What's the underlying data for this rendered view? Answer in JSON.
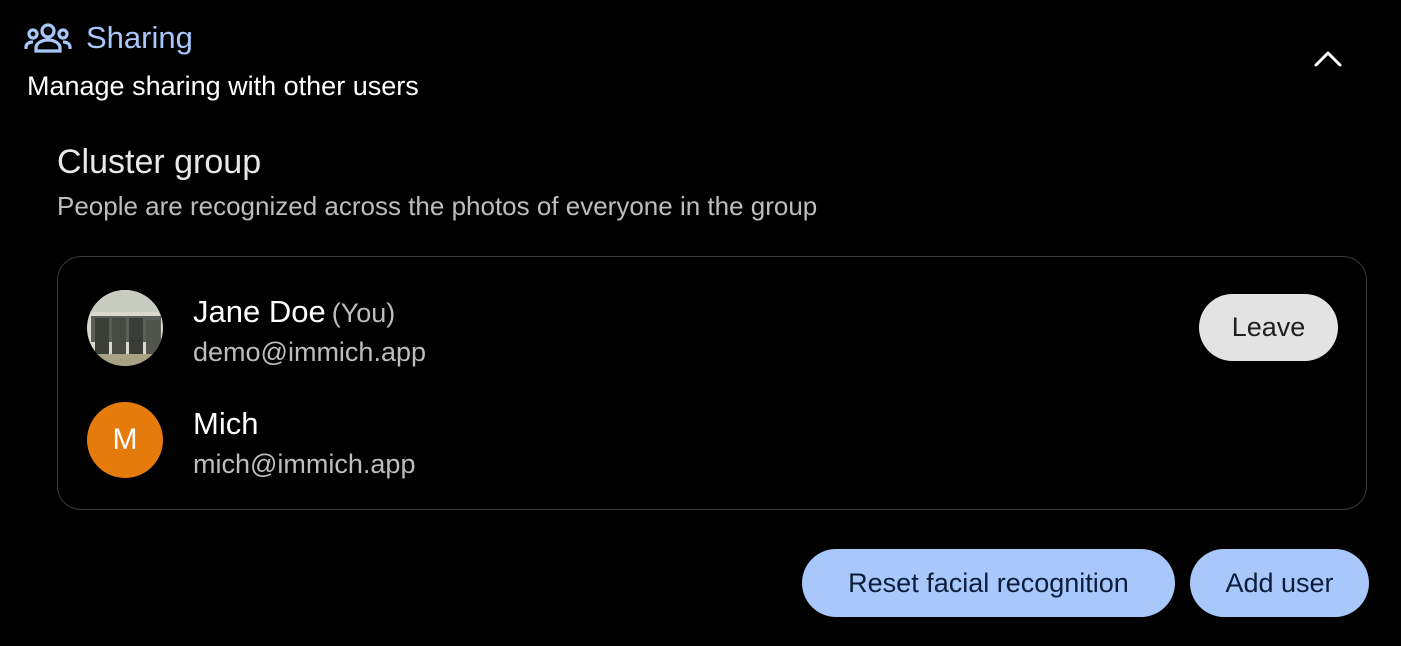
{
  "section": {
    "icon": "people-icon",
    "title": "Sharing",
    "subtitle": "Manage sharing with other users",
    "collapse_icon": "chevron-up-icon",
    "accent_color": "#a8c7fa"
  },
  "cluster_group": {
    "title": "Cluster group",
    "description": "People are recognized across the photos of everyone in the group",
    "members": [
      {
        "name": "Jane Doe",
        "you_label": "(You)",
        "email": "demo@immich.app",
        "avatar": "photo-avatar",
        "action_label": "Leave"
      },
      {
        "name": "Mich",
        "email": "mich@immich.app",
        "avatar_letter": "M",
        "avatar_color": "#e57a0d"
      }
    ]
  },
  "actions": {
    "reset_label": "Reset facial recognition",
    "add_user_label": "Add user"
  }
}
